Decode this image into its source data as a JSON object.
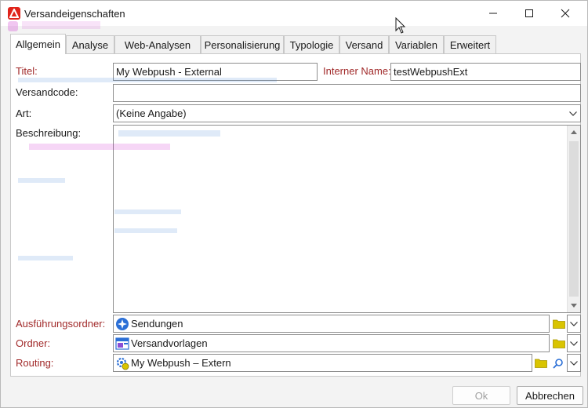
{
  "window": {
    "title": "Versandeigenschaften"
  },
  "tabs": [
    {
      "label": "Allgemein",
      "active": true
    },
    {
      "label": "Analyse"
    },
    {
      "label": "Web-Analysen"
    },
    {
      "label": "Personalisierung"
    },
    {
      "label": "Typologie"
    },
    {
      "label": "Versand"
    },
    {
      "label": "Variablen"
    },
    {
      "label": "Erweitert"
    }
  ],
  "form": {
    "title_label": "Titel:",
    "title_value": "My Webpush - External",
    "internal_name_label": "Interner Name:",
    "internal_name_value": "testWebpushExt",
    "delivery_code_label": "Versandcode:",
    "delivery_code_value": "",
    "type_label": "Art:",
    "type_value": "(Keine Angabe)",
    "description_label": "Beschreibung:",
    "description_value": "",
    "execution_folder_label": "Ausführungsordner:",
    "execution_folder_value": "Sendungen",
    "folder_label": "Ordner:",
    "folder_value": "Versandvorlagen",
    "routing_label": "Routing:",
    "routing_value": "My Webpush – Extern"
  },
  "buttons": {
    "ok_label": "Ok",
    "cancel_label": "Abbrechen"
  },
  "colors": {
    "label_red": "#a12a2a",
    "app_icon": "#e0241b",
    "folder_yellow": "#d9c400",
    "execution_icon_blue": "#2b6fd6"
  }
}
